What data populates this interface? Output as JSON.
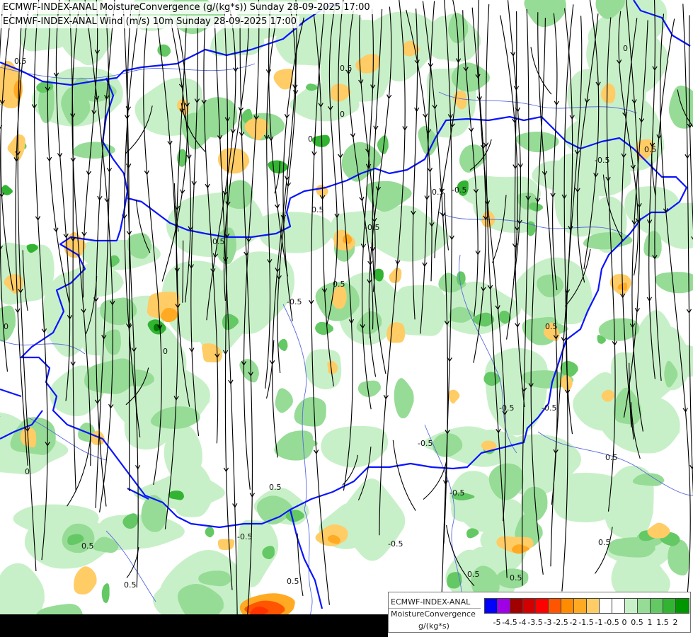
{
  "titles": {
    "line1": "ECMWF-INDEX-ANAL MoistureConvergence (g/(kg*s)) Sunday 28-09-2025 17:00",
    "line2": "ECMWF-INDEX-ANAL Wind (m/s) 10m Sunday 28-09-2025 17:00"
  },
  "legend": {
    "model": "ECMWF-INDEX-ANAL",
    "parameter": "MoistureConvergence",
    "unit": "g/(kg*s)",
    "colors": [
      "#0000ff",
      "#a000e6",
      "#a00000",
      "#d20000",
      "#ff0000",
      "#ff5500",
      "#ff8c00",
      "#ffaa22",
      "#ffcc66",
      "#ffffff",
      "#ffffff",
      "#c8f0c8",
      "#96dc96",
      "#64c864",
      "#32b432",
      "#009600"
    ],
    "tick_labels": [
      "-5",
      "-4.5",
      "-4",
      "-3.5",
      "-3",
      "-2.5",
      "-2",
      "-1.5",
      "-1",
      "-0.5",
      "0",
      "0.5",
      "1",
      "1.5",
      "2"
    ]
  },
  "contour_labels": [
    "0.5",
    "0.5",
    "0.5",
    "0.5",
    "0.5",
    "0.5",
    "0.5",
    "0.5",
    "0.5",
    "0.5",
    "0.5",
    "0.5",
    "0.5",
    "0.5",
    "0.5",
    "0.5",
    "0",
    "0",
    "0",
    "0",
    "0",
    "0",
    "-0.5",
    "-0.5",
    "-0.5",
    "-0.5",
    "-0.5",
    "-0.5",
    "-0.5",
    "-0.5",
    "-0.5",
    "-0.5"
  ],
  "map_colors": {
    "green_light": "#c8f0c8",
    "green_mid": "#96dc96",
    "green_dark": "#64c864",
    "green_deep": "#32b432",
    "orange_light": "#ffcc66",
    "orange_mid": "#ffaa22",
    "orange_deep": "#ff5500",
    "border": "#0a14ff",
    "river": "#5a6adf",
    "streamline": "#000000"
  }
}
